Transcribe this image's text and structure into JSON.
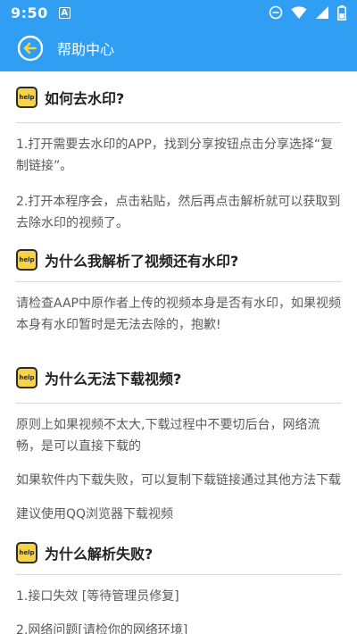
{
  "status_bar": {
    "time": "9:50",
    "notification_letter": "A"
  },
  "app_bar": {
    "title": "帮助中心"
  },
  "colors": {
    "primary": "#2f9ef3",
    "badge_yellow": "#f7d347"
  },
  "badge_label": "help",
  "sections": [
    {
      "title": "如何去水印?",
      "paragraphs": [
        "1.打开需要去水印的APP，找到分享按钮点击分享选择“复制链接”。",
        "2.打开本程序会，点击粘贴，然后再点击解析就可以获取到去除水印的视频了。"
      ]
    },
    {
      "title": "为什么我解析了视频还有水印?",
      "paragraphs": [
        "请检查AAP中原作者上传的视频本身是否有水印，如果视频本身有水印暂时是无法去除的，抱歉!"
      ]
    },
    {
      "title": "为什么无法下载视频?",
      "paragraphs": [
        "原则上如果视频不太大,下载过程中不要切后台，网络流畅，是可以直接下载的",
        "如果软件内下载失败，可以复制下载链接通过其他方法下载",
        "建议使用QQ浏览器下载视频"
      ]
    },
    {
      "title": "为什么解析失败?",
      "paragraphs": [
        "1.接口失效 [等待管理员修复]",
        "2.网络问题[请检你的网络环境]"
      ]
    }
  ]
}
